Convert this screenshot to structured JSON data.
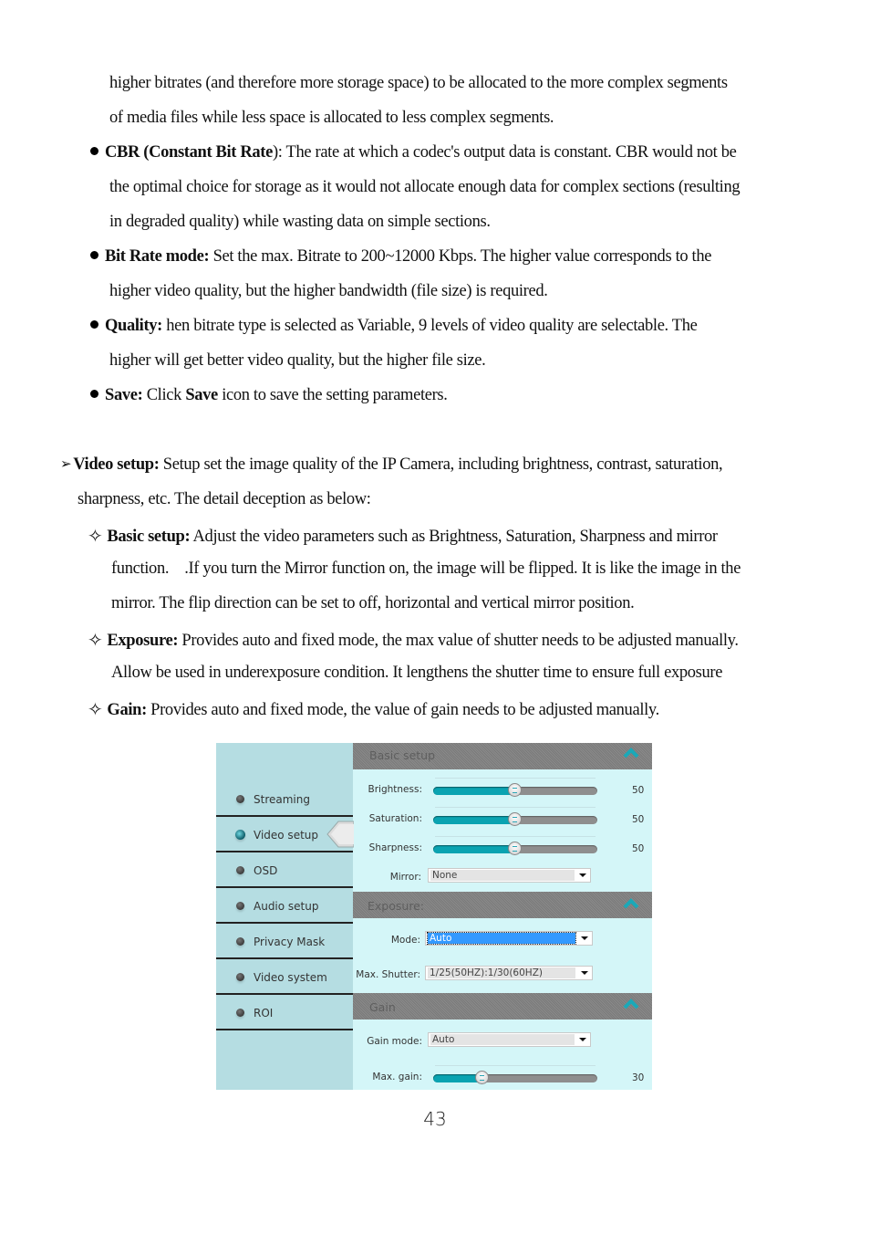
{
  "doc": {
    "lines": {
      "l1": "higher bitrates (and therefore more storage space) to be allocated to the more complex segments",
      "l2": "of media files while less space is allocated to less complex segments.",
      "cbr_term": "CBR (Constant Bit Rate",
      "cbr_rest": "): The rate at which a codec's output data is constant. CBR would not be",
      "cbr_2": "the optimal choice for storage as it would not allocate enough data for complex sections (resulting",
      "cbr_3": "in degraded quality) while wasting data on simple sections.",
      "brm_term": "Bit Rate mode:",
      "brm_rest": " Set the max. Bitrate to 200~12000 Kbps. The higher value corresponds to the",
      "brm_2": "higher video quality, but the higher bandwidth (file size) is required.",
      "q_term": "Quality:",
      "q_rest": " hen bitrate type is selected as Variable, 9 levels of video quality are selectable. The",
      "q_2": "higher will get better video quality, but the higher file size.",
      "save_term": "Save:",
      "save_mid": " Click ",
      "save_bold": "Save",
      "save_rest": " icon to save the setting parameters.",
      "vs_term": "Video setup:",
      "vs_rest": " Setup set the image quality of the IP Camera, including brightness, contrast, saturation,",
      "vs_2": "sharpness, etc. The detail deception as below:",
      "bs_term": "Basic setup:",
      "bs_rest": " Adjust the video parameters such as Brightness, Saturation, Sharpness and mirror",
      "bs_2": "function.    .If you turn the Mirror function on, the image will be flipped. It is like the image in the",
      "bs_3": "mirror. The flip direction can be set to off, horizontal and vertical mirror position.",
      "ex_term": "Exposure:",
      "ex_rest": " Provides auto and fixed mode, the max value of shutter needs to be adjusted manually.",
      "ex_2": "Allow be used in underexposure condition. It lengthens the shutter time to ensure full exposure",
      "gain_term": "Gain:",
      "gain_rest": " Provides auto and fixed mode, the value of gain needs to be adjusted manually."
    },
    "glyphs": {
      "bullet": "filled-circle",
      "arrow": "➢",
      "diamond": "✧"
    },
    "page_number": "43"
  },
  "ui": {
    "nav": {
      "items": [
        {
          "label": "Streaming",
          "active": false
        },
        {
          "label": "Video setup",
          "active": true
        },
        {
          "label": "OSD",
          "active": false
        },
        {
          "label": "Audio setup",
          "active": false
        },
        {
          "label": "Privacy Mask",
          "active": false
        },
        {
          "label": "Video system",
          "active": false
        },
        {
          "label": "ROI",
          "active": false
        }
      ]
    },
    "basic": {
      "title": "Basic setup",
      "brightness": {
        "label": "Brightness:",
        "value": "50",
        "fraction": 0.5
      },
      "saturation": {
        "label": "Saturation:",
        "value": "50",
        "fraction": 0.5
      },
      "sharpness": {
        "label": "Sharpness:",
        "value": "50",
        "fraction": 0.5
      },
      "mirror": {
        "label": "Mirror:",
        "value": "None"
      }
    },
    "exposure": {
      "title": "Exposure:",
      "mode": {
        "label": "Mode:",
        "value": "Auto"
      },
      "max_shutter": {
        "label": "Max. Shutter:",
        "value": "1/25(50HZ):1/30(60HZ)"
      }
    },
    "gain": {
      "title": "Gain",
      "gain_mode": {
        "label": "Gain mode:",
        "value": "Auto"
      },
      "max_gain": {
        "label": "Max. gain:",
        "value": "30",
        "fraction": 0.3
      }
    },
    "colors": {
      "accent": "#0aa3b1",
      "nav_bg": "#b5dde2",
      "panel_bg": "#d4f6f8",
      "header_bg": "#808080",
      "selected": "#3399ff"
    }
  }
}
